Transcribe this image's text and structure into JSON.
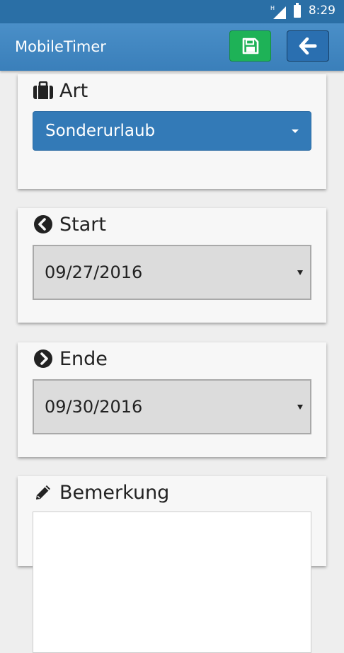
{
  "status_bar": {
    "time": "8:29",
    "network": "H"
  },
  "header": {
    "title": "MobileTimer"
  },
  "toolbar": {
    "save_icon": "floppy-disk",
    "back_icon": "arrow-left"
  },
  "colors": {
    "nav": "#3a7fba",
    "save": "#1eb257",
    "back": "#2a6fb0",
    "select": "#337ab7"
  },
  "form": {
    "art": {
      "label": "Art",
      "icon": "briefcase",
      "value": "Sonderurlaub"
    },
    "start": {
      "label": "Start",
      "icon": "chevron-circle-left",
      "value": "09/27/2016"
    },
    "ende": {
      "label": "Ende",
      "icon": "chevron-circle-right",
      "value": "09/30/2016"
    },
    "bemerkung": {
      "label": "Bemerkung",
      "icon": "pencil",
      "value": ""
    }
  }
}
